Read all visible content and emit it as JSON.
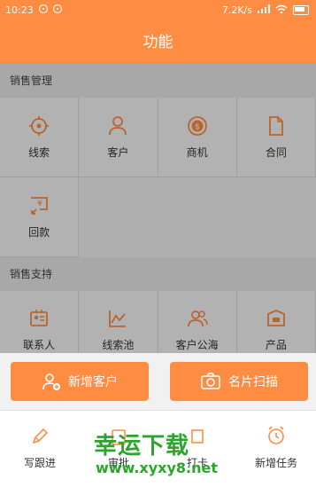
{
  "status": {
    "time": "10:23",
    "speed": "7.2K/s"
  },
  "header": {
    "title": "功能"
  },
  "sections": {
    "sales_management": {
      "title": "销售管理",
      "items": [
        {
          "label": "线索",
          "icon": "target-icon"
        },
        {
          "label": "客户",
          "icon": "person-icon"
        },
        {
          "label": "商机",
          "icon": "dollar-coin-icon"
        },
        {
          "label": "合同",
          "icon": "document-icon"
        },
        {
          "label": "回款",
          "icon": "yuan-payment-icon"
        }
      ]
    },
    "sales_support": {
      "title": "销售支持",
      "items": [
        {
          "label": "联系人",
          "icon": "contact-card-icon"
        },
        {
          "label": "线索池",
          "icon": "chart-trend-icon"
        },
        {
          "label": "客户公海",
          "icon": "people-group-icon"
        },
        {
          "label": "产品",
          "icon": "product-box-icon"
        }
      ]
    }
  },
  "actions": {
    "add_customer": "新增客户",
    "scan_card": "名片扫描"
  },
  "tabs": {
    "follow_up": "写跟进",
    "tab2": "审批",
    "tab3": "打卡",
    "new_task": "新增任务"
  },
  "watermark": {
    "big": "幸运下载",
    "small": "www.xyxy8.net"
  },
  "colors": {
    "accent": "#ff8c43",
    "watermark": "#2ca52c"
  }
}
